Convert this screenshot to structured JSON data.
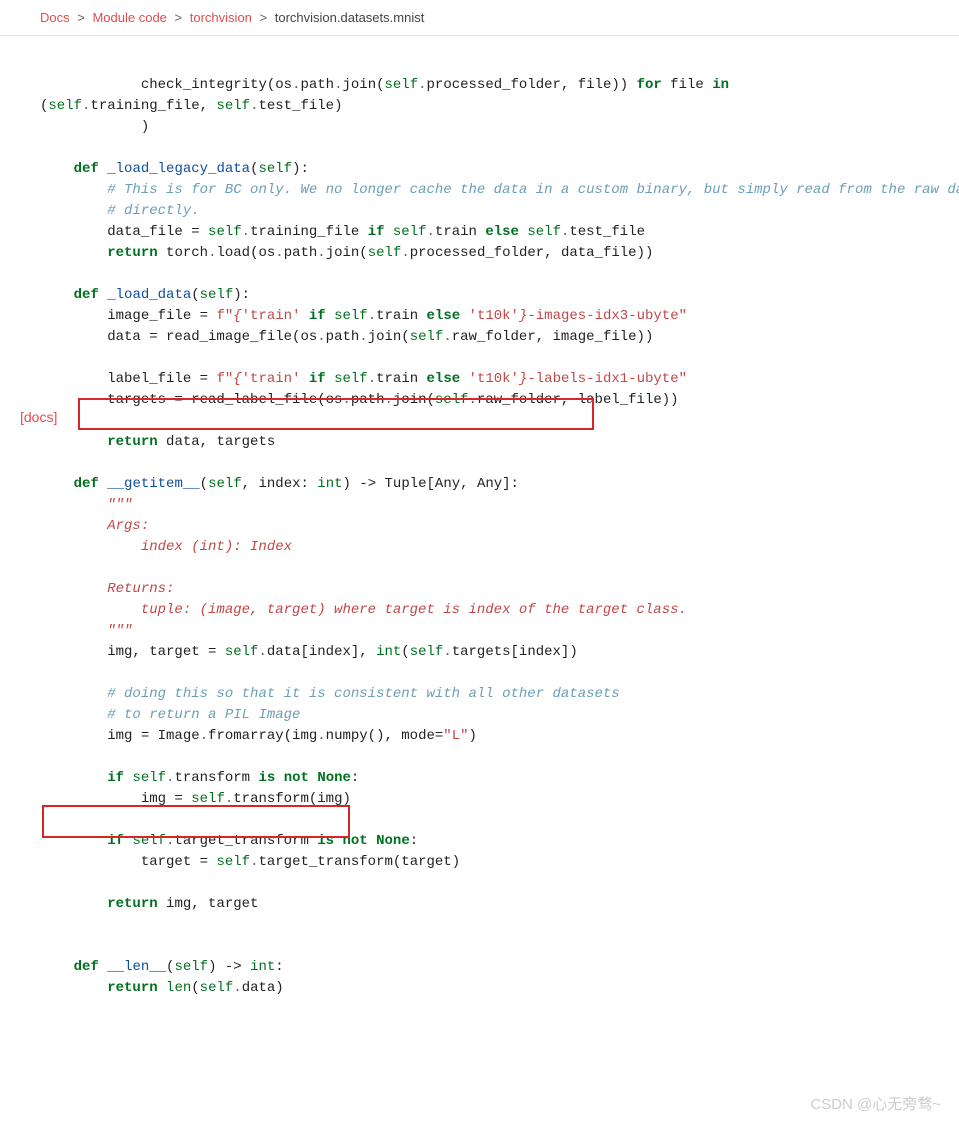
{
  "breadcrumb": {
    "docs": "Docs",
    "mod": "Module code",
    "tv": "torchvision",
    "cur": "torchvision.datasets.mnist"
  },
  "docs_label": "[docs]",
  "code": {
    "l01a": "check_integrity(os",
    "l01b": "path",
    "l01c": "join(",
    "l01d": "processed_folder, file)) ",
    "l01e": " file ",
    "l02a": "training_file, ",
    "l02b": "test_file)",
    "l03p": "            )",
    "l04def": "_load_legacy_data",
    "l05c": "# This is for BC only. We no longer cache the data in a custom binary, but simply read from the raw data",
    "l06c": "# directly.",
    "l07a": "data_file = ",
    "l07b": "training_file ",
    "l07c": "train ",
    "l07d": "test_file",
    "l08a": " torch",
    "l08b": "load(os",
    "l08c": "path",
    "l08d": "join(",
    "l08e": "processed_folder, data_file))",
    "l09def": "_load_data",
    "l10a": "image_file = ",
    "l10s1": "f\"",
    "l10s2": "{",
    "l10s3": "'train'",
    "l10s4": "train ",
    "l10s5": "'t10k'",
    "l10s6": "}",
    "l10s7": "-images-idx3-ubyte\"",
    "l11a": "data = read_image_file(os",
    "l11b": "path",
    "l11c": "join(",
    "l11d": "raw_folder, image_file))",
    "l12a": "label_file = ",
    "l12s7": "-labels-idx1-ubyte\"",
    "l13a": "targets = read_label_file(os",
    "l13d": "raw_folder, label_file))",
    "l14a": " data, targets",
    "l15def": "__getitem__",
    "l15a": "index: ",
    "l15b": ") -> Tuple[Any, Any]:",
    "l16d": "        \"\"\"",
    "l17d": "        Args:",
    "l18d": "            index (int): Index",
    "l19d": "        Returns:",
    "l20d": "            tuple: (image, target) where target is index of the target class.",
    "l21d": "        \"\"\"",
    "l22a": "img, target = ",
    "l22b": "data[index], ",
    "l22c": "targets[index])",
    "l23c": "# doing this so that it is consistent with all other datasets",
    "l24c": "# to return a PIL Image",
    "l25a": "img = Image",
    "l25b": "fromarray(img",
    "l25c": "numpy(), mode=",
    "l25s": "\"L\"",
    "l26a": "transform ",
    "l27a": "img = ",
    "l27b": "transform(img)",
    "l28a": "target_transform ",
    "l29a": "target = ",
    "l29b": "target_transform(target)",
    "l30a": " img, target",
    "l31def": "__len__",
    "l31a": ") -> ",
    "l32a": "data)",
    "kw_def": "def",
    "kw_self": "self",
    "kw_for": "for",
    "kw_in": "in",
    "kw_if": "if",
    "kw_else": "else",
    "kw_return": "return",
    "kw_is": "is",
    "kw_not": "not",
    "kw_None": "None",
    "tp_int": "int",
    "tp_len": "len",
    "dot": "."
  },
  "watermark": "CSDN @心无旁骛~"
}
